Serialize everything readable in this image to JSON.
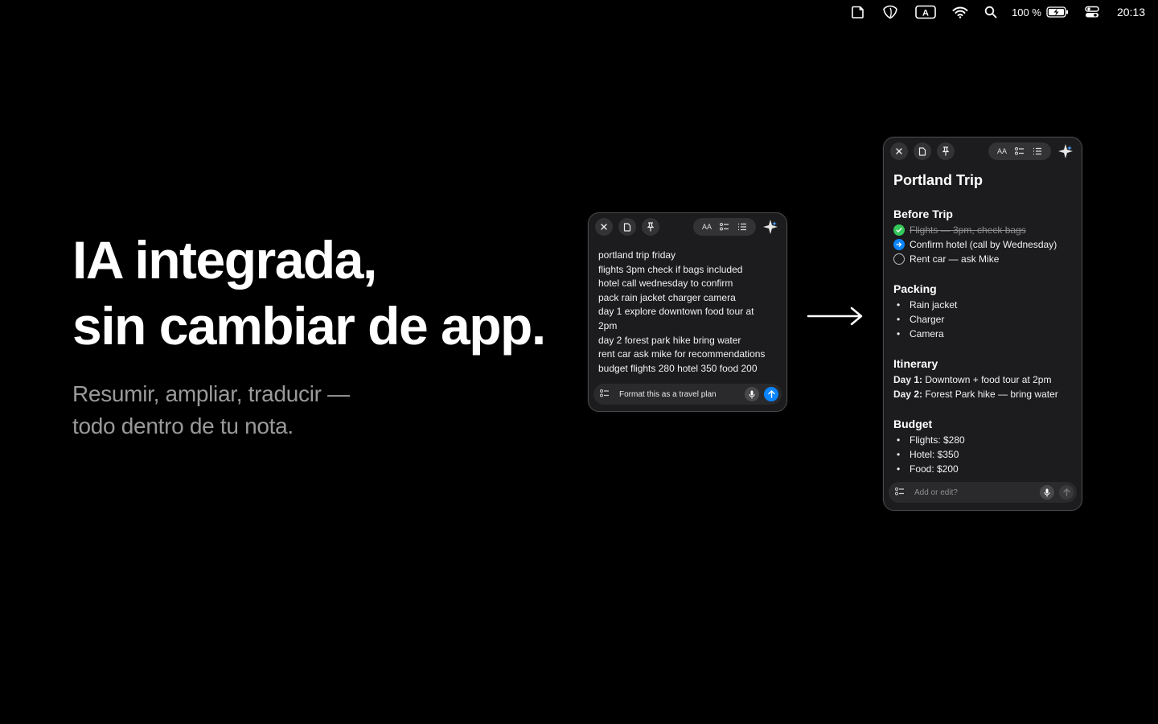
{
  "menubar": {
    "battery_percent": "100 %",
    "clock": "20:13",
    "icons": [
      "note-icon",
      "shield-icon",
      "input-source-icon",
      "wifi-icon",
      "search-icon",
      "battery-icon",
      "control-center-icon"
    ]
  },
  "hero": {
    "title_line1": "IA integrada,",
    "title_line2": "sin cambiar de app.",
    "subtitle_line1": "Resumir, ampliar, traducir —",
    "subtitle_line2": "todo dentro de tu nota."
  },
  "raw_note": {
    "toolbar_text_size": "AA",
    "lines": [
      "portland trip friday",
      "flights 3pm check if bags included",
      "hotel call wednesday to confirm",
      "pack rain jacket charger camera",
      "day 1 explore downtown food tour at",
      "2pm",
      "day 2 forest park hike bring water",
      "rent car ask mike for recommendations",
      "budget flights 280 hotel 350 food 200"
    ],
    "prompt": "Format this as a travel plan"
  },
  "formatted_note": {
    "toolbar_text_size": "AA",
    "title": "Portland Trip",
    "before_trip": {
      "heading": "Before Trip",
      "items": [
        {
          "text": "Flights — 3pm, check bags",
          "state": "done"
        },
        {
          "text": "Confirm hotel (call by Wednesday)",
          "state": "in-progress"
        },
        {
          "text": "Rent car — ask Mike",
          "state": "todo"
        }
      ]
    },
    "packing": {
      "heading": "Packing",
      "items": [
        "Rain jacket",
        "Charger",
        "Camera"
      ]
    },
    "itinerary": {
      "heading": "Itinerary",
      "days": [
        {
          "label": "Day 1:",
          "text": " Downtown + food tour at 2pm"
        },
        {
          "label": "Day 2:",
          "text": " Forest Park hike — bring water"
        }
      ]
    },
    "budget": {
      "heading": "Budget",
      "items": [
        "Flights: $280",
        "Hotel: $350",
        "Food: $200"
      ]
    },
    "prompt_placeholder": "Add or edit?"
  },
  "colors": {
    "background": "#000000",
    "window": "#1c1c1e",
    "accent_blue": "#0a84ff",
    "check_green": "#34c759",
    "muted_text": "#9a9a9a"
  }
}
